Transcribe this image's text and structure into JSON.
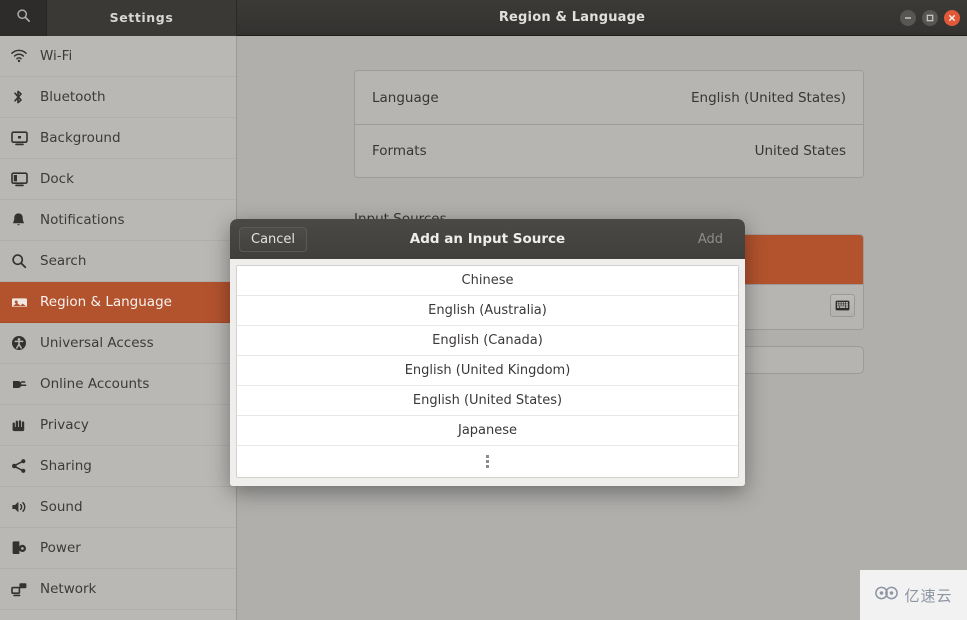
{
  "titlebar": {
    "search_icon": "search-icon",
    "settings_label": "Settings",
    "title": "Region & Language",
    "controls": {
      "minimize": "–",
      "maximize": "□",
      "close": "✕"
    }
  },
  "sidebar": {
    "items": [
      {
        "label": "Wi-Fi",
        "icon": "wifi-icon",
        "active": false
      },
      {
        "label": "Bluetooth",
        "icon": "bluetooth-icon",
        "active": false
      },
      {
        "label": "Background",
        "icon": "monitor-icon",
        "active": false
      },
      {
        "label": "Dock",
        "icon": "dock-icon",
        "active": false
      },
      {
        "label": "Notifications",
        "icon": "bell-icon",
        "active": false
      },
      {
        "label": "Search",
        "icon": "magnifier-icon",
        "active": false
      },
      {
        "label": "Region & Language",
        "icon": "flag-icon",
        "active": true
      },
      {
        "label": "Universal Access",
        "icon": "accessibility-icon",
        "active": false
      },
      {
        "label": "Online Accounts",
        "icon": "plug-icon",
        "active": false
      },
      {
        "label": "Privacy",
        "icon": "hand-icon",
        "active": false
      },
      {
        "label": "Sharing",
        "icon": "share-icon",
        "active": false
      },
      {
        "label": "Sound",
        "icon": "speaker-icon",
        "active": false
      },
      {
        "label": "Power",
        "icon": "power-icon",
        "active": false
      },
      {
        "label": "Network",
        "icon": "network-icon",
        "active": false
      }
    ]
  },
  "main": {
    "language_row": {
      "label": "Language",
      "value": "English (United States)"
    },
    "formats_row": {
      "label": "Formats",
      "value": "United States"
    },
    "input_sources_label": "Input Sources",
    "keyboard_button_icon": "keyboard-icon"
  },
  "dialog": {
    "cancel_label": "Cancel",
    "title": "Add an Input Source",
    "add_label": "Add",
    "items": [
      "Chinese",
      "English (Australia)",
      "English (Canada)",
      "English (United Kingdom)",
      "English (United States)",
      "Japanese"
    ],
    "more_indicator": "more-vertical-icon"
  },
  "watermark": {
    "text": "亿速云",
    "icon": "cloud-logo-icon"
  },
  "colors": {
    "accent_orange": "#b3532e",
    "titlebar_dark": "#3b3a37",
    "sidebar_bg": "#b9b8b5",
    "content_bg": "#b0afac",
    "dialog_head": "#4a4946",
    "close_button": "#e2593a"
  }
}
